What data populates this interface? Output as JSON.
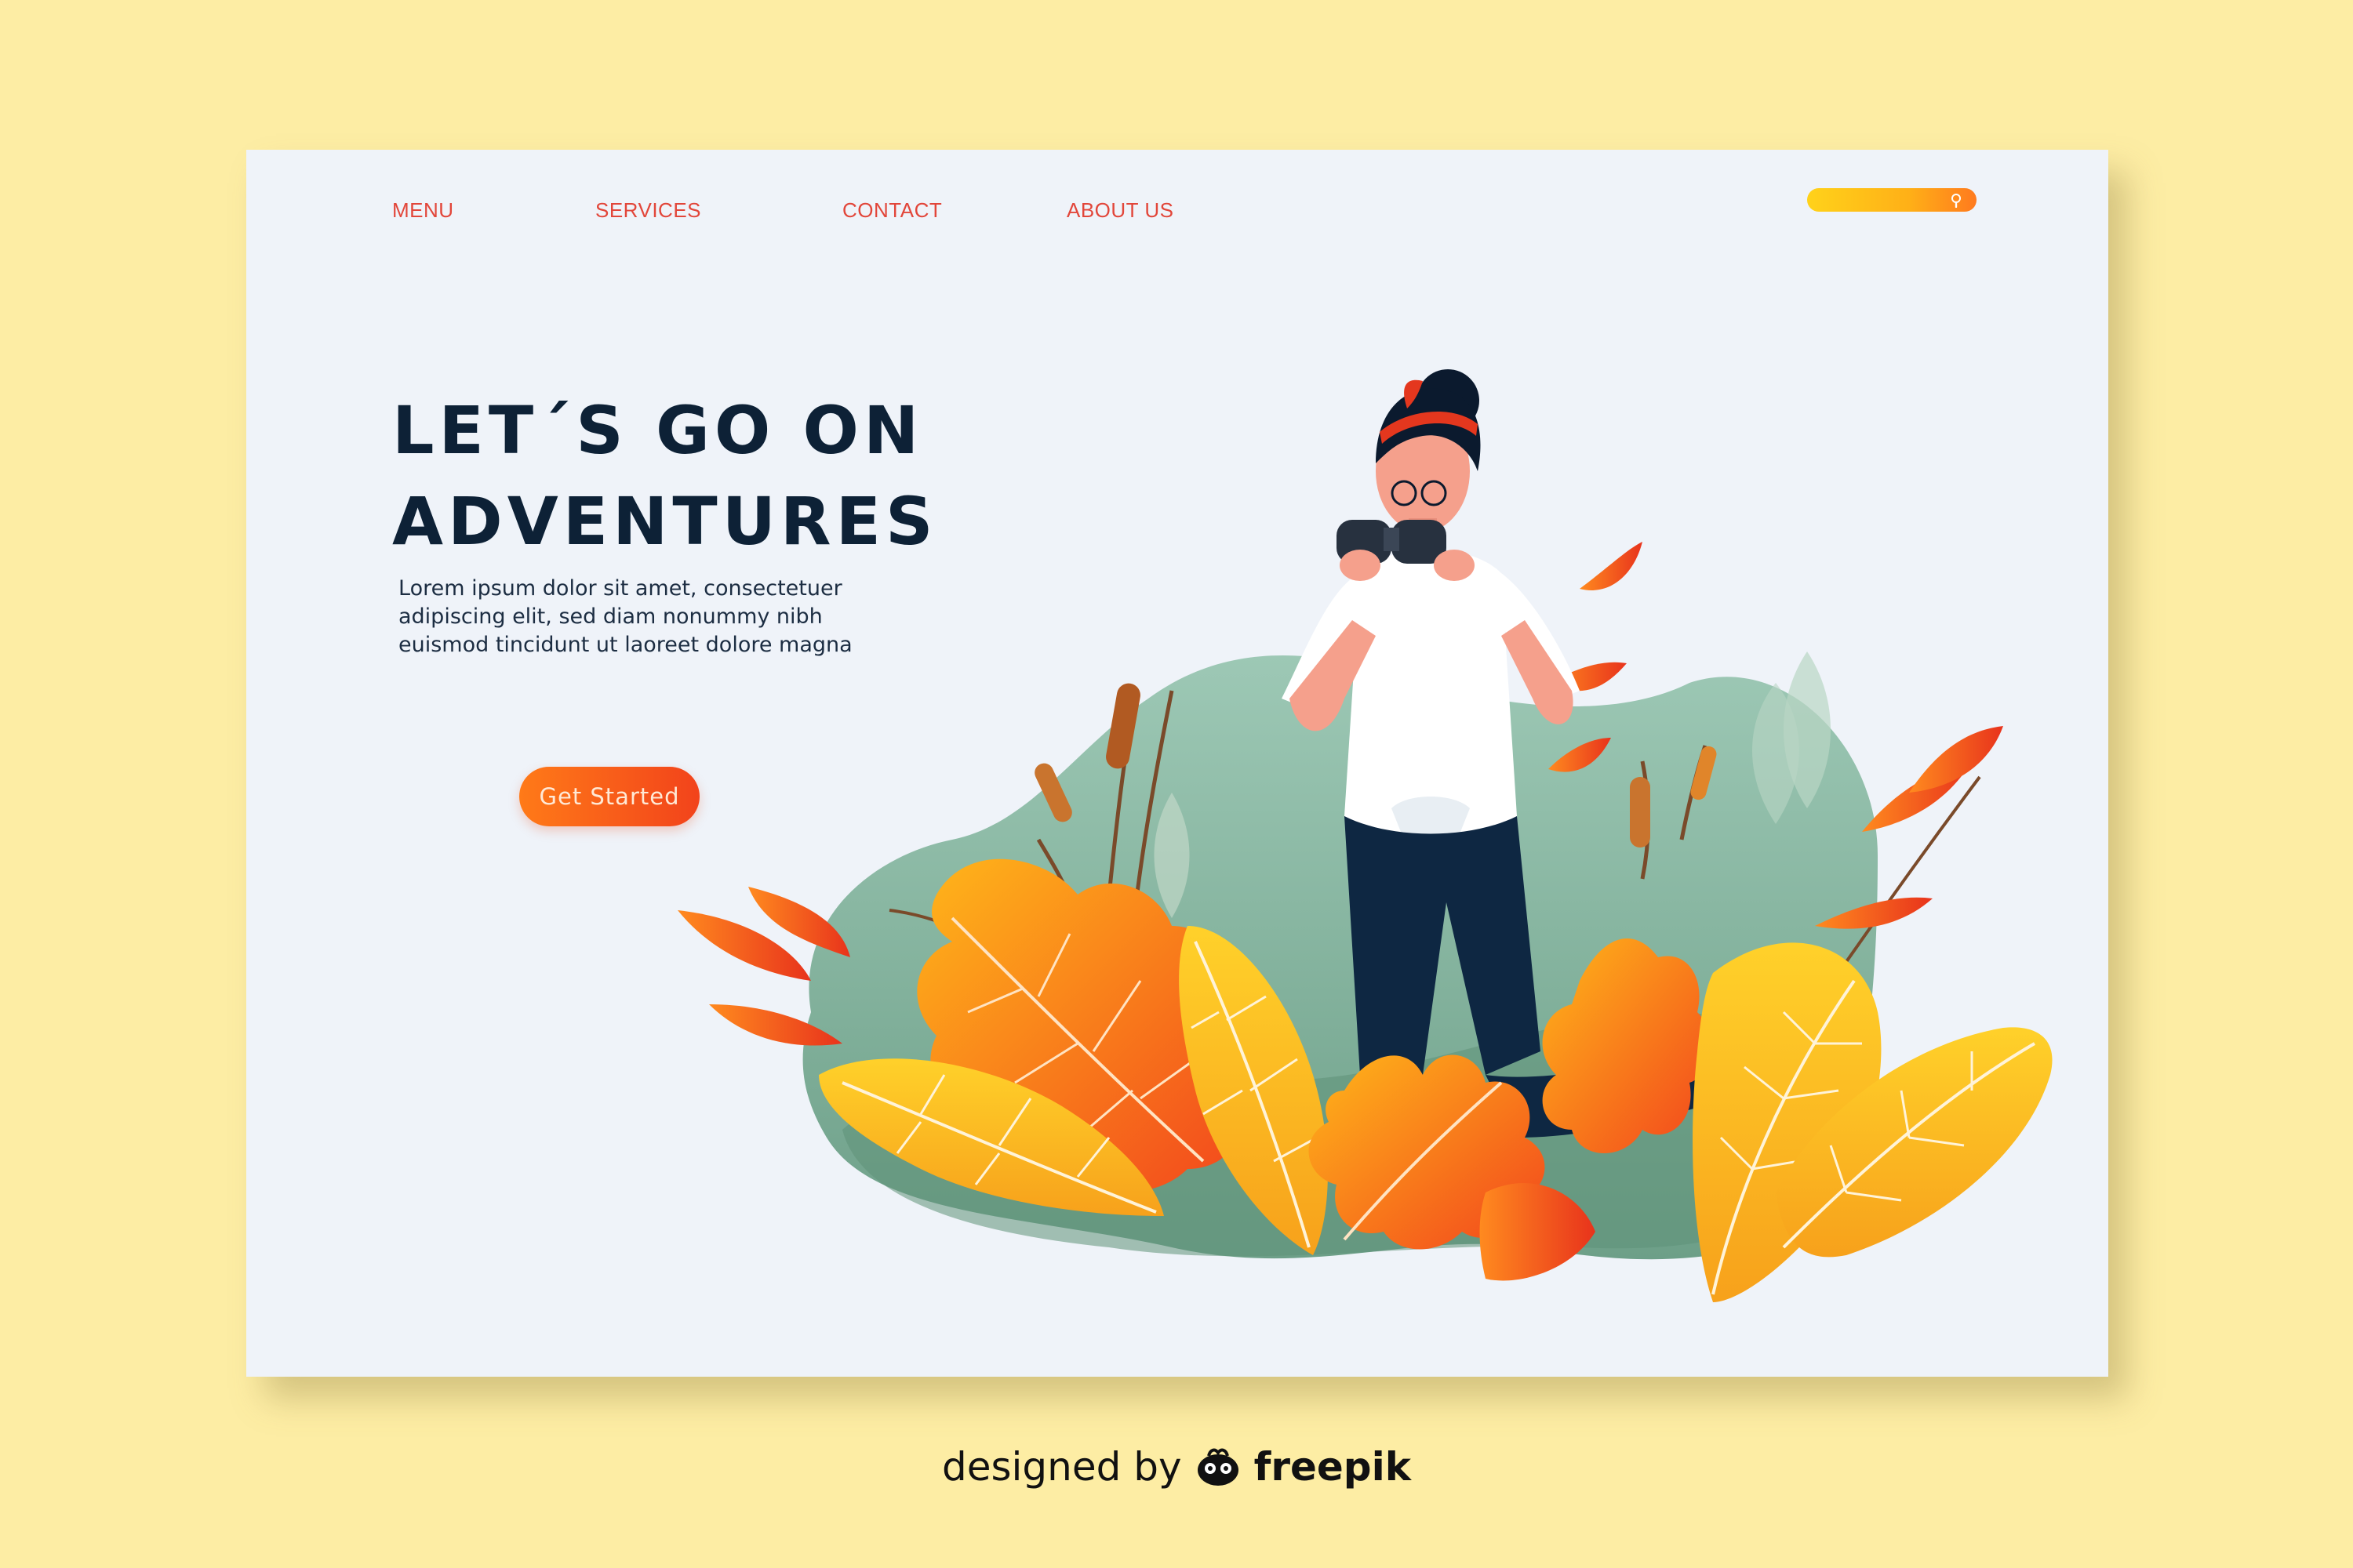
{
  "nav": {
    "items": [
      {
        "label": "MENU"
      },
      {
        "label": "SERVICES"
      },
      {
        "label": "CONTACT"
      },
      {
        "label": "ABOUT US"
      }
    ],
    "search_icon": "search-icon"
  },
  "hero": {
    "title_line1": "LET´S GO ON",
    "title_line2": "ADVENTURES",
    "body_line1": "Lorem ipsum dolor sit amet, consectetuer",
    "body_line2": "adipiscing elit, sed diam nonummy nibh",
    "body_line3": "euismod tincidunt ut laoreet dolore magna",
    "cta_label": "Get Started"
  },
  "footer": {
    "credit_prefix": "designed by",
    "credit_brand": "freepik",
    "logo_icon": "freepik-logo-icon"
  },
  "colors": {
    "page_background": "#fdeda4",
    "card_background": "#eff3f9",
    "accent": "#e2463a",
    "headline": "#0d2136",
    "blob": "#8fc0ae"
  }
}
